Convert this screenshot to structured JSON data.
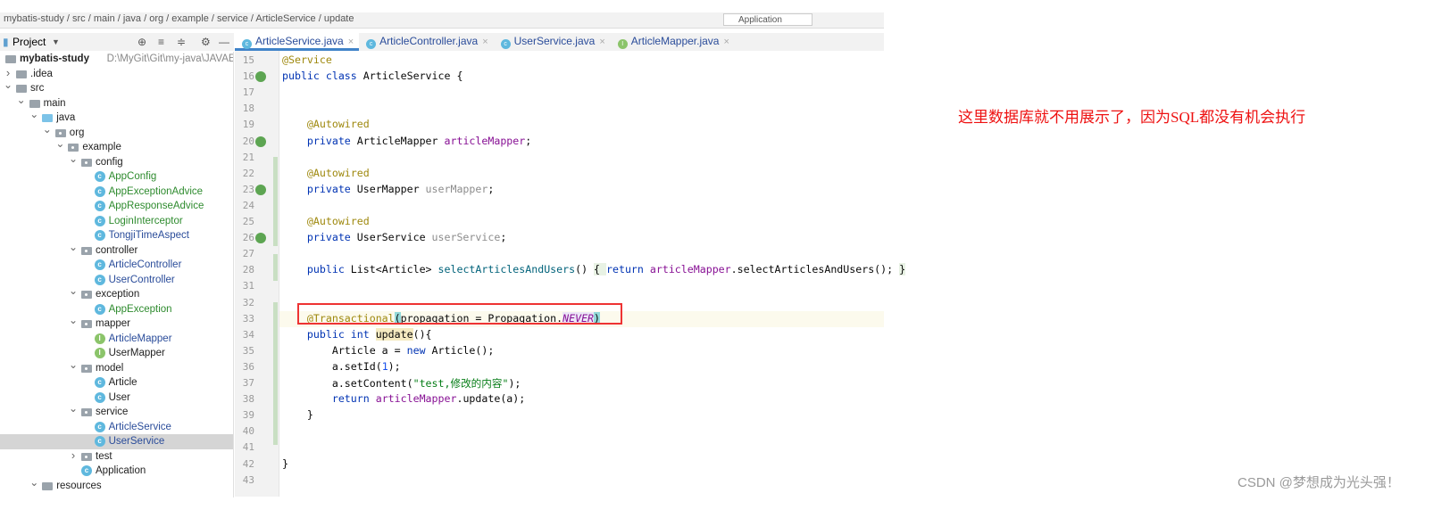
{
  "breadcrumb": "mybatis-study / src / main / java / org / example / service / ArticleService / update",
  "run_config": "Application",
  "project_panel": {
    "title": "Project",
    "root_path": "D:\\MyGit\\Git\\my-java\\JAVAEE\\myb"
  },
  "tree": [
    {
      "label": "mybatis-study",
      "depth": 0,
      "arrow": "none",
      "icon": "module",
      "bold": true
    },
    {
      "label": ".idea",
      "depth": 0,
      "arrow": "closed",
      "icon": "folder"
    },
    {
      "label": "src",
      "depth": 0,
      "arrow": "open",
      "icon": "folder"
    },
    {
      "label": "main",
      "depth": 1,
      "arrow": "open",
      "icon": "folder"
    },
    {
      "label": "java",
      "depth": 2,
      "arrow": "open",
      "icon": "source"
    },
    {
      "label": "org",
      "depth": 3,
      "arrow": "open",
      "icon": "package"
    },
    {
      "label": "example",
      "depth": 4,
      "arrow": "open",
      "icon": "package"
    },
    {
      "label": "config",
      "depth": 5,
      "arrow": "open",
      "icon": "package"
    },
    {
      "label": "AppConfig",
      "depth": 6,
      "arrow": "none",
      "icon": "class",
      "color": "#2e8b2e"
    },
    {
      "label": "AppExceptionAdvice",
      "depth": 6,
      "arrow": "none",
      "icon": "class",
      "color": "#2e8b2e"
    },
    {
      "label": "AppResponseAdvice",
      "depth": 6,
      "arrow": "none",
      "icon": "class",
      "color": "#2e8b2e"
    },
    {
      "label": "LoginInterceptor",
      "depth": 6,
      "arrow": "none",
      "icon": "class",
      "color": "#2e8b2e"
    },
    {
      "label": "TongjiTimeAspect",
      "depth": 6,
      "arrow": "none",
      "icon": "class",
      "color": "#2a4c9a"
    },
    {
      "label": "controller",
      "depth": 5,
      "arrow": "open",
      "icon": "package"
    },
    {
      "label": "ArticleController",
      "depth": 6,
      "arrow": "none",
      "icon": "class",
      "color": "#2a4c9a"
    },
    {
      "label": "UserController",
      "depth": 6,
      "arrow": "none",
      "icon": "class",
      "color": "#2a4c9a"
    },
    {
      "label": "exception",
      "depth": 5,
      "arrow": "open",
      "icon": "package"
    },
    {
      "label": "AppException",
      "depth": 6,
      "arrow": "none",
      "icon": "class",
      "color": "#2e8b2e"
    },
    {
      "label": "mapper",
      "depth": 5,
      "arrow": "open",
      "icon": "package"
    },
    {
      "label": "ArticleMapper",
      "depth": 6,
      "arrow": "none",
      "icon": "interface",
      "color": "#2a4c9a"
    },
    {
      "label": "UserMapper",
      "depth": 6,
      "arrow": "none",
      "icon": "interface"
    },
    {
      "label": "model",
      "depth": 5,
      "arrow": "open",
      "icon": "package"
    },
    {
      "label": "Article",
      "depth": 6,
      "arrow": "none",
      "icon": "class"
    },
    {
      "label": "User",
      "depth": 6,
      "arrow": "none",
      "icon": "class"
    },
    {
      "label": "service",
      "depth": 5,
      "arrow": "open",
      "icon": "package"
    },
    {
      "label": "ArticleService",
      "depth": 6,
      "arrow": "none",
      "icon": "class",
      "color": "#2a4c9a"
    },
    {
      "label": "UserService",
      "depth": 6,
      "arrow": "none",
      "icon": "class",
      "color": "#2a4c9a",
      "selected": true
    },
    {
      "label": "test",
      "depth": 5,
      "arrow": "closed",
      "icon": "package"
    },
    {
      "label": "Application",
      "depth": 5,
      "arrow": "none",
      "icon": "app"
    },
    {
      "label": "resources",
      "depth": 2,
      "arrow": "open",
      "icon": "folder"
    }
  ],
  "tabs": [
    {
      "label": "ArticleService.java",
      "icon": "class",
      "active": true
    },
    {
      "label": "ArticleController.java",
      "icon": "class"
    },
    {
      "label": "UserService.java",
      "icon": "class"
    },
    {
      "label": "ArticleMapper.java",
      "icon": "interface"
    }
  ],
  "code_lines": [
    {
      "n": "15",
      "tokens": [
        [
          "ann",
          "@Service"
        ]
      ]
    },
    {
      "n": "16",
      "bean": true,
      "tokens": [
        [
          "kw",
          "public class "
        ],
        [
          "",
          "ArticleService {"
        ]
      ]
    },
    {
      "n": "17",
      "tokens": []
    },
    {
      "n": "18",
      "tokens": []
    },
    {
      "n": "19",
      "tokens": [
        [
          "",
          "    "
        ],
        [
          "ann",
          "@Autowired"
        ]
      ]
    },
    {
      "n": "20",
      "bean": true,
      "tokens": [
        [
          "",
          "    "
        ],
        [
          "kw",
          "private "
        ],
        [
          "",
          "ArticleMapper "
        ],
        [
          "fld",
          "articleMapper"
        ],
        [
          "",
          ";"
        ]
      ]
    },
    {
      "n": "21",
      "tokens": []
    },
    {
      "n": "22",
      "tokens": [
        [
          "",
          "    "
        ],
        [
          "ann",
          "@Autowired"
        ]
      ]
    },
    {
      "n": "23",
      "bean": true,
      "tokens": [
        [
          "",
          "    "
        ],
        [
          "kw",
          "private "
        ],
        [
          "",
          "UserMapper "
        ],
        [
          "gry",
          "userMapper"
        ],
        [
          "",
          ";"
        ]
      ]
    },
    {
      "n": "24",
      "tokens": []
    },
    {
      "n": "25",
      "tokens": [
        [
          "",
          "    "
        ],
        [
          "ann",
          "@Autowired"
        ]
      ]
    },
    {
      "n": "26",
      "bean": true,
      "tokens": [
        [
          "",
          "    "
        ],
        [
          "kw",
          "private "
        ],
        [
          "",
          "UserService "
        ],
        [
          "gry",
          "userService"
        ],
        [
          "",
          ";"
        ]
      ]
    },
    {
      "n": "27",
      "tokens": []
    },
    {
      "n": "28",
      "tokens": [
        [
          "",
          "    "
        ],
        [
          "kw",
          "public "
        ],
        [
          "",
          "List<Article> "
        ],
        [
          "fn",
          "selectArticlesAndUsers"
        ],
        [
          "",
          "() "
        ],
        [
          "fb",
          "{ "
        ],
        [
          "kw",
          "return "
        ],
        [
          "fld",
          "articleMapper"
        ],
        [
          "",
          ".selectArticlesAndUsers(); "
        ],
        [
          "fb",
          "}"
        ]
      ]
    },
    {
      "n": "31",
      "tokens": []
    },
    {
      "n": "32",
      "tokens": []
    },
    {
      "n": "33",
      "current": true,
      "tokens": [
        [
          "",
          "    "
        ],
        [
          "ann",
          "@Transactional"
        ],
        [
          "br",
          "("
        ],
        [
          "",
          "propagation = Propagation."
        ],
        [
          "st",
          "NEVER"
        ],
        [
          "br",
          ")"
        ]
      ]
    },
    {
      "n": "34",
      "tokens": [
        [
          "",
          "    "
        ],
        [
          "kw",
          "public int "
        ],
        [
          "hl",
          "update"
        ],
        [
          "",
          "(){"
        ]
      ]
    },
    {
      "n": "35",
      "tokens": [
        [
          "",
          "        Article a = "
        ],
        [
          "kw",
          "new "
        ],
        [
          "",
          "Article();"
        ]
      ]
    },
    {
      "n": "36",
      "tokens": [
        [
          "",
          "        a.setId("
        ],
        [
          "num",
          "1"
        ],
        [
          "",
          ");"
        ]
      ]
    },
    {
      "n": "37",
      "tokens": [
        [
          "",
          "        a.setContent("
        ],
        [
          "str",
          "\"test,修改的内容\""
        ],
        [
          "",
          ");"
        ]
      ]
    },
    {
      "n": "38",
      "tokens": [
        [
          "",
          "        "
        ],
        [
          "kw",
          "return "
        ],
        [
          "fld",
          "articleMapper"
        ],
        [
          "",
          ".update(a);"
        ]
      ]
    },
    {
      "n": "39",
      "tokens": [
        [
          "",
          "    }"
        ]
      ]
    },
    {
      "n": "40",
      "tokens": []
    },
    {
      "n": "41",
      "tokens": []
    },
    {
      "n": "42",
      "tokens": [
        [
          "",
          "}"
        ]
      ]
    },
    {
      "n": "43",
      "tokens": []
    }
  ],
  "annotation_note": "这里数据库就不用展示了，因为SQL都没有机会执行",
  "watermark": "CSDN @梦想成为光头强！",
  "colors": {
    "highlight_box": "#ee3333",
    "note_text": "#ee1111",
    "tab_accent": "#4083c9"
  }
}
